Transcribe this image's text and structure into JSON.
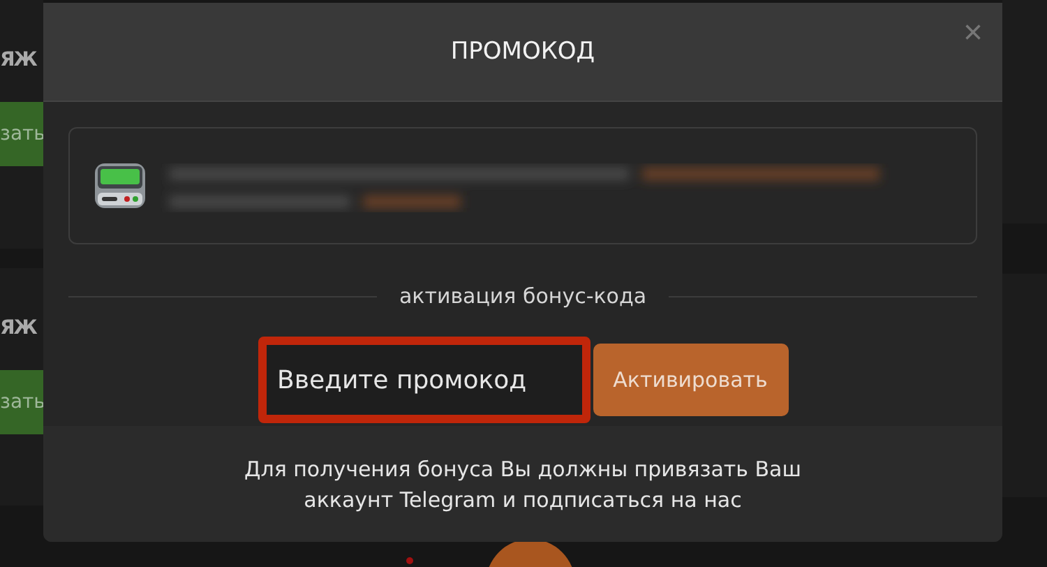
{
  "background": {
    "headings": [
      "ЯЖ",
      "ЯЖ"
    ],
    "buttons": [
      "зать",
      "зать"
    ]
  },
  "modal": {
    "title": "ПРОМОКОД",
    "close": "×",
    "divider_label": "активация бонус-кода",
    "promo_field": {
      "placeholder": "Введите промокод",
      "highlighted": true
    },
    "activate_button": "Активировать",
    "footer": "Для получения бонуса Вы должны привязать Ваш\nаккаунт Telegram и подписаться на нас"
  }
}
